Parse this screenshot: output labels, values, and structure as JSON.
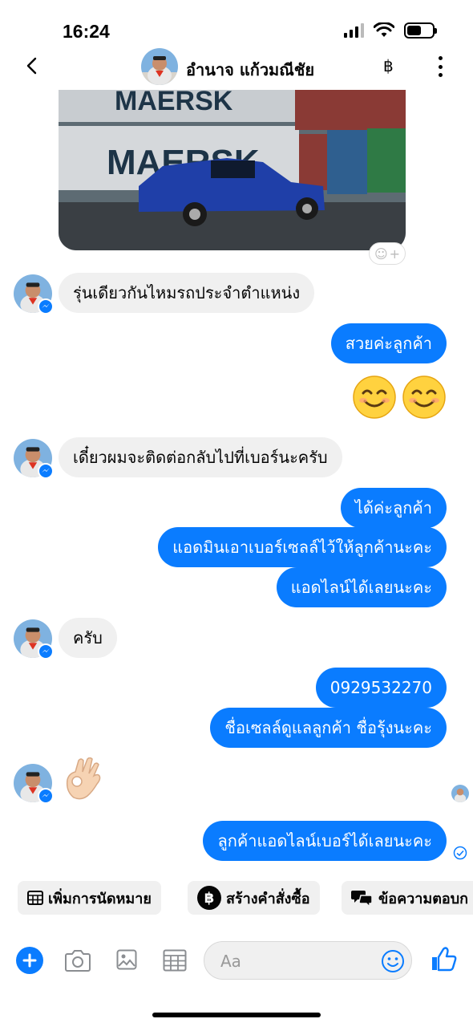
{
  "status": {
    "time": "16:24"
  },
  "header": {
    "contact_name": "อำนาจ แก้วมณีชัย",
    "currency_symbol": "฿"
  },
  "photo": {
    "text_top": "MAERSK",
    "text_bottom": "MAERSK"
  },
  "messages": [
    {
      "from": "contact",
      "text": "รุ่นเดียวกันไหมรถประจำตำแหน่ง"
    },
    {
      "from": "me",
      "text": "สวยค่ะลูกค้า"
    },
    {
      "from": "contact",
      "text": "เดี๋ยวผมจะติดต่อกลับไปที่เบอร์นะครับ"
    },
    {
      "from": "me",
      "text": "ได้ค่ะลูกค้า"
    },
    {
      "from": "me",
      "text": "แอดมินเอาเบอร์เซลล์ไว้ให้ลูกค้านะคะ"
    },
    {
      "from": "me",
      "text": "แอดไลน์ได้เลยนะคะ"
    },
    {
      "from": "contact",
      "text": "ครับ"
    },
    {
      "from": "me",
      "text": "0929532270"
    },
    {
      "from": "me",
      "text": "ชื่อเซลล์ดูแลลูกค้า ชื่อรุ้งนะคะ"
    },
    {
      "from": "me",
      "text": "ลูกค้าแอดไลน์เบอร์ได้เลยนะคะ"
    }
  ],
  "quick_replies": [
    {
      "label": "เพิ่มการนัดหมาย",
      "icon": "calendar-icon"
    },
    {
      "label": "สร้างคำสั่งซื้อ",
      "icon": "baht-circle-icon"
    },
    {
      "label": "ข้อความตอบก",
      "icon": "chat-bubbles-icon"
    }
  ],
  "composer": {
    "placeholder": "Aa"
  },
  "colors": {
    "accent": "#0a7cff",
    "incoming_bg": "#f0f0f0"
  }
}
